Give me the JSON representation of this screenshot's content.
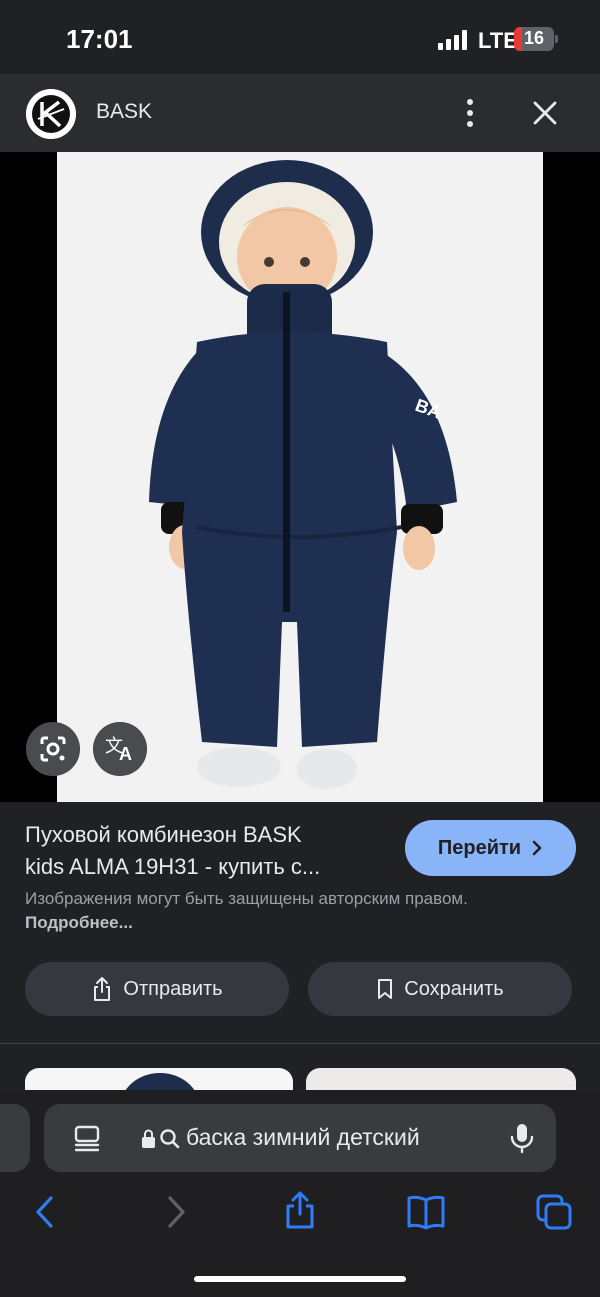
{
  "status_bar": {
    "time": "17:01",
    "network": "LTE",
    "battery": "16"
  },
  "header": {
    "site_name": "BASK"
  },
  "image": {
    "description_icons": [
      "google-lens-icon",
      "translate-icon"
    ]
  },
  "result": {
    "title_line1": "Пуховой комбинезон BASK",
    "title_line2": "kids ALMA 19H31 - купить с...",
    "go_button": "Перейти",
    "copyright_text": "Изображения могут быть защищены авторским правом.",
    "copyright_more": "Подробнее..."
  },
  "actions": {
    "share_label": "Отправить",
    "save_label": "Сохранить"
  },
  "browser": {
    "url_text": "баска зимний детский"
  },
  "colors": {
    "background": "#202124",
    "accent": "#8ab4f8",
    "button_bg": "#35393f",
    "ios_blue": "#2f7cf6"
  }
}
